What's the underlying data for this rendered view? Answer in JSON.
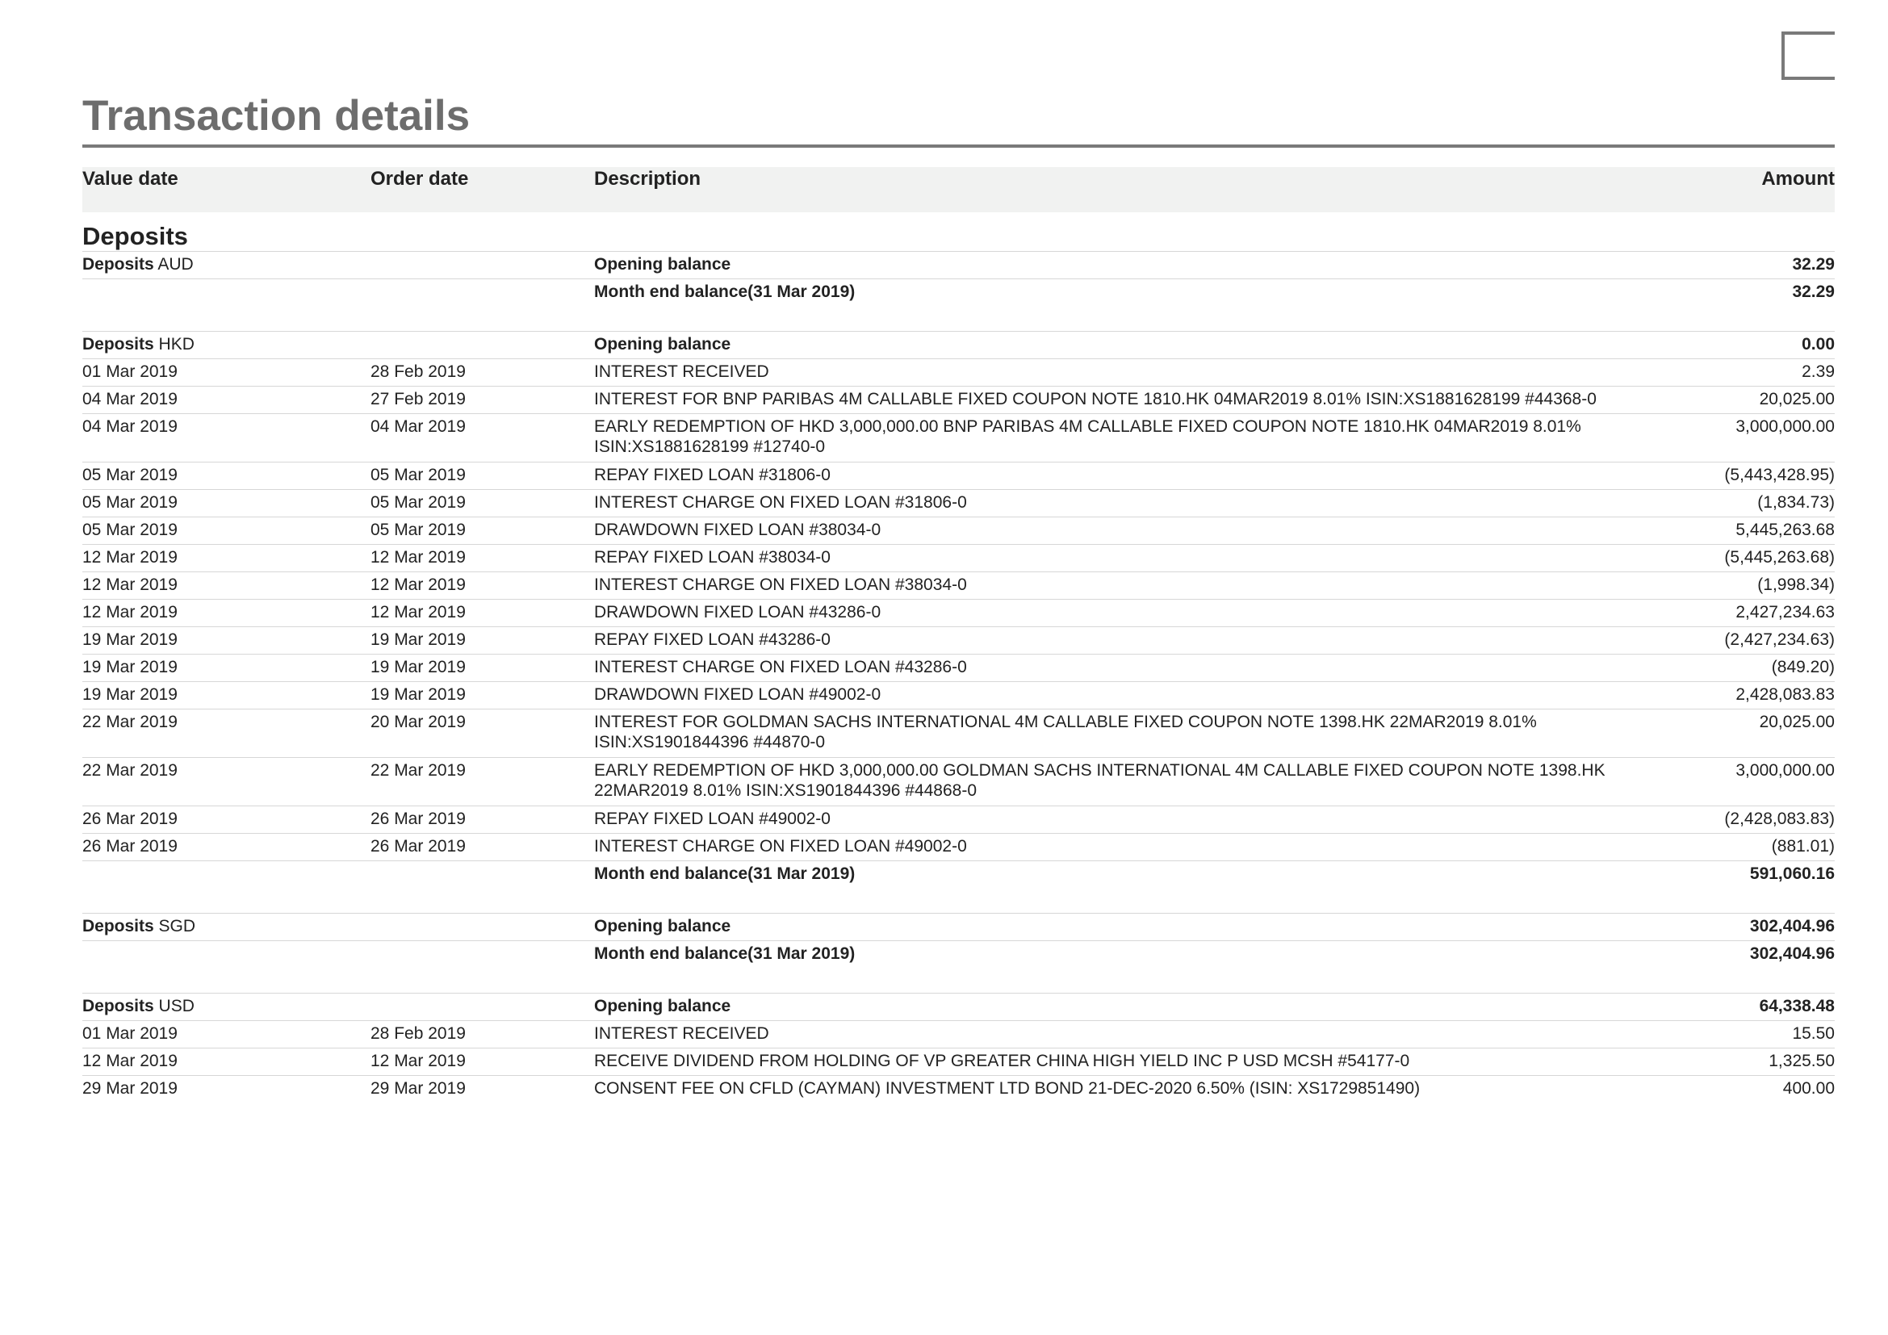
{
  "page": {
    "title": "Transaction details"
  },
  "columns": {
    "value_date": "Value date",
    "order_date": "Order date",
    "description": "Description",
    "amount": "Amount"
  },
  "section": {
    "title": "Deposits"
  },
  "groups": [
    {
      "label": "Deposits",
      "currency": "AUD",
      "opening_label": "Opening balance",
      "opening_amount": "32.29",
      "transactions": [],
      "closing_label": "Month end balance(31 Mar 2019)",
      "closing_amount": "32.29"
    },
    {
      "label": "Deposits",
      "currency": "HKD",
      "opening_label": "Opening balance",
      "opening_amount": "0.00",
      "transactions": [
        {
          "value_date": "01 Mar 2019",
          "order_date": "28 Feb 2019",
          "description": "INTEREST RECEIVED",
          "amount": "2.39"
        },
        {
          "value_date": "04 Mar 2019",
          "order_date": "27 Feb 2019",
          "description": "INTEREST FOR BNP PARIBAS 4M CALLABLE FIXED COUPON NOTE 1810.HK 04MAR2019 8.01% ISIN:XS1881628199 #44368-0",
          "amount": "20,025.00"
        },
        {
          "value_date": "04 Mar 2019",
          "order_date": "04 Mar 2019",
          "description": "EARLY REDEMPTION OF HKD 3,000,000.00 BNP PARIBAS 4M CALLABLE FIXED COUPON NOTE 1810.HK 04MAR2019 8.01% ISIN:XS1881628199 #12740-0",
          "amount": "3,000,000.00"
        },
        {
          "value_date": "05 Mar 2019",
          "order_date": "05 Mar 2019",
          "description": "REPAY FIXED LOAN #31806-0",
          "amount": "(5,443,428.95)"
        },
        {
          "value_date": "05 Mar 2019",
          "order_date": "05 Mar 2019",
          "description": "INTEREST CHARGE ON FIXED LOAN #31806-0",
          "amount": "(1,834.73)"
        },
        {
          "value_date": "05 Mar 2019",
          "order_date": "05 Mar 2019",
          "description": "DRAWDOWN FIXED LOAN #38034-0",
          "amount": "5,445,263.68"
        },
        {
          "value_date": "12 Mar 2019",
          "order_date": "12 Mar 2019",
          "description": "REPAY FIXED LOAN #38034-0",
          "amount": "(5,445,263.68)"
        },
        {
          "value_date": "12 Mar 2019",
          "order_date": "12 Mar 2019",
          "description": "INTEREST CHARGE ON FIXED LOAN #38034-0",
          "amount": "(1,998.34)"
        },
        {
          "value_date": "12 Mar 2019",
          "order_date": "12 Mar 2019",
          "description": "DRAWDOWN FIXED LOAN #43286-0",
          "amount": "2,427,234.63"
        },
        {
          "value_date": "19 Mar 2019",
          "order_date": "19 Mar 2019",
          "description": "REPAY FIXED LOAN #43286-0",
          "amount": "(2,427,234.63)"
        },
        {
          "value_date": "19 Mar 2019",
          "order_date": "19 Mar 2019",
          "description": "INTEREST CHARGE ON FIXED LOAN #43286-0",
          "amount": "(849.20)"
        },
        {
          "value_date": "19 Mar 2019",
          "order_date": "19 Mar 2019",
          "description": "DRAWDOWN FIXED LOAN #49002-0",
          "amount": "2,428,083.83"
        },
        {
          "value_date": "22 Mar 2019",
          "order_date": "20 Mar 2019",
          "description": "INTEREST FOR GOLDMAN SACHS INTERNATIONAL 4M CALLABLE FIXED COUPON NOTE 1398.HK 22MAR2019 8.01% ISIN:XS1901844396 #44870-0",
          "amount": "20,025.00"
        },
        {
          "value_date": "22 Mar 2019",
          "order_date": "22 Mar 2019",
          "description": "EARLY REDEMPTION OF HKD 3,000,000.00 GOLDMAN SACHS INTERNATIONAL 4M CALLABLE FIXED COUPON NOTE 1398.HK 22MAR2019 8.01% ISIN:XS1901844396 #44868-0",
          "amount": "3,000,000.00"
        },
        {
          "value_date": "26 Mar 2019",
          "order_date": "26 Mar 2019",
          "description": "REPAY FIXED LOAN #49002-0",
          "amount": "(2,428,083.83)"
        },
        {
          "value_date": "26 Mar 2019",
          "order_date": "26 Mar 2019",
          "description": "INTEREST CHARGE ON FIXED LOAN #49002-0",
          "amount": "(881.01)"
        }
      ],
      "closing_label": "Month end balance(31 Mar 2019)",
      "closing_amount": "591,060.16"
    },
    {
      "label": "Deposits",
      "currency": "SGD",
      "opening_label": "Opening balance",
      "opening_amount": "302,404.96",
      "transactions": [],
      "closing_label": "Month end balance(31 Mar 2019)",
      "closing_amount": "302,404.96"
    },
    {
      "label": "Deposits",
      "currency": "USD",
      "opening_label": "Opening balance",
      "opening_amount": "64,338.48",
      "transactions": [
        {
          "value_date": "01 Mar 2019",
          "order_date": "28 Feb 2019",
          "description": "INTEREST RECEIVED",
          "amount": "15.50"
        },
        {
          "value_date": "12 Mar 2019",
          "order_date": "12 Mar 2019",
          "description": "RECEIVE DIVIDEND FROM HOLDING OF VP GREATER CHINA HIGH YIELD INC P USD MCSH #54177-0",
          "amount": "1,325.50"
        },
        {
          "value_date": "29 Mar 2019",
          "order_date": "29 Mar 2019",
          "description": "CONSENT FEE ON CFLD (CAYMAN) INVESTMENT LTD BOND 21-DEC-2020 6.50% (ISIN: XS1729851490)",
          "amount": "400.00"
        }
      ],
      "closing_label": null,
      "closing_amount": null
    }
  ]
}
